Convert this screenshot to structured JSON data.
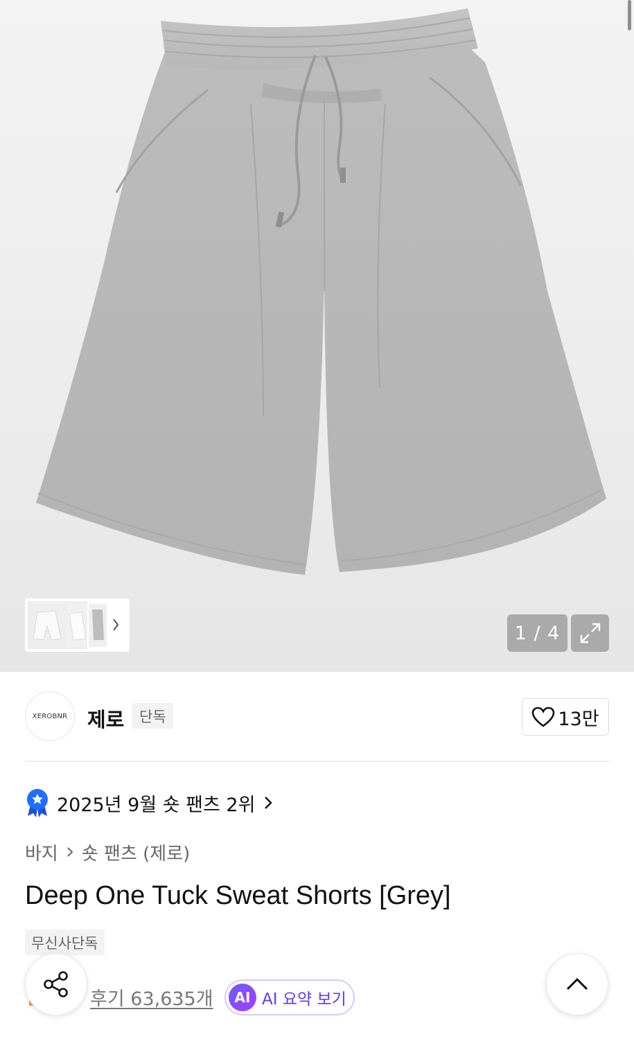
{
  "gallery": {
    "counter": "1 / 4",
    "product_alt": "grey-sweat-shorts-photo",
    "icons": {
      "expand": "expand-icon",
      "thumbs_next": "chevron-right-icon"
    }
  },
  "brand": {
    "logo_text": "XEROBNR",
    "name": "제로",
    "exclusive_tag": "단독",
    "like_count": "13만",
    "like_icon": "heart-outline-icon"
  },
  "ranking": {
    "text": "2025년 9월 숏 팬츠 2위",
    "icon": "rank-medal-icon",
    "accent": "#1f6fff"
  },
  "breadcrumb": {
    "level1": "바지",
    "level2": "숏 팬츠 (제로)"
  },
  "product": {
    "title": "Deep One Tuck Sweat Shorts [Grey]",
    "tag": "무신사단독"
  },
  "reviews": {
    "label": "후기 63,635개"
  },
  "ai_summary": {
    "badge": "AI",
    "label": "AI 요약 보기",
    "accent": "#5b3cf0"
  },
  "fabs": {
    "share_icon": "share-icon",
    "top_icon": "chevron-up-icon"
  }
}
